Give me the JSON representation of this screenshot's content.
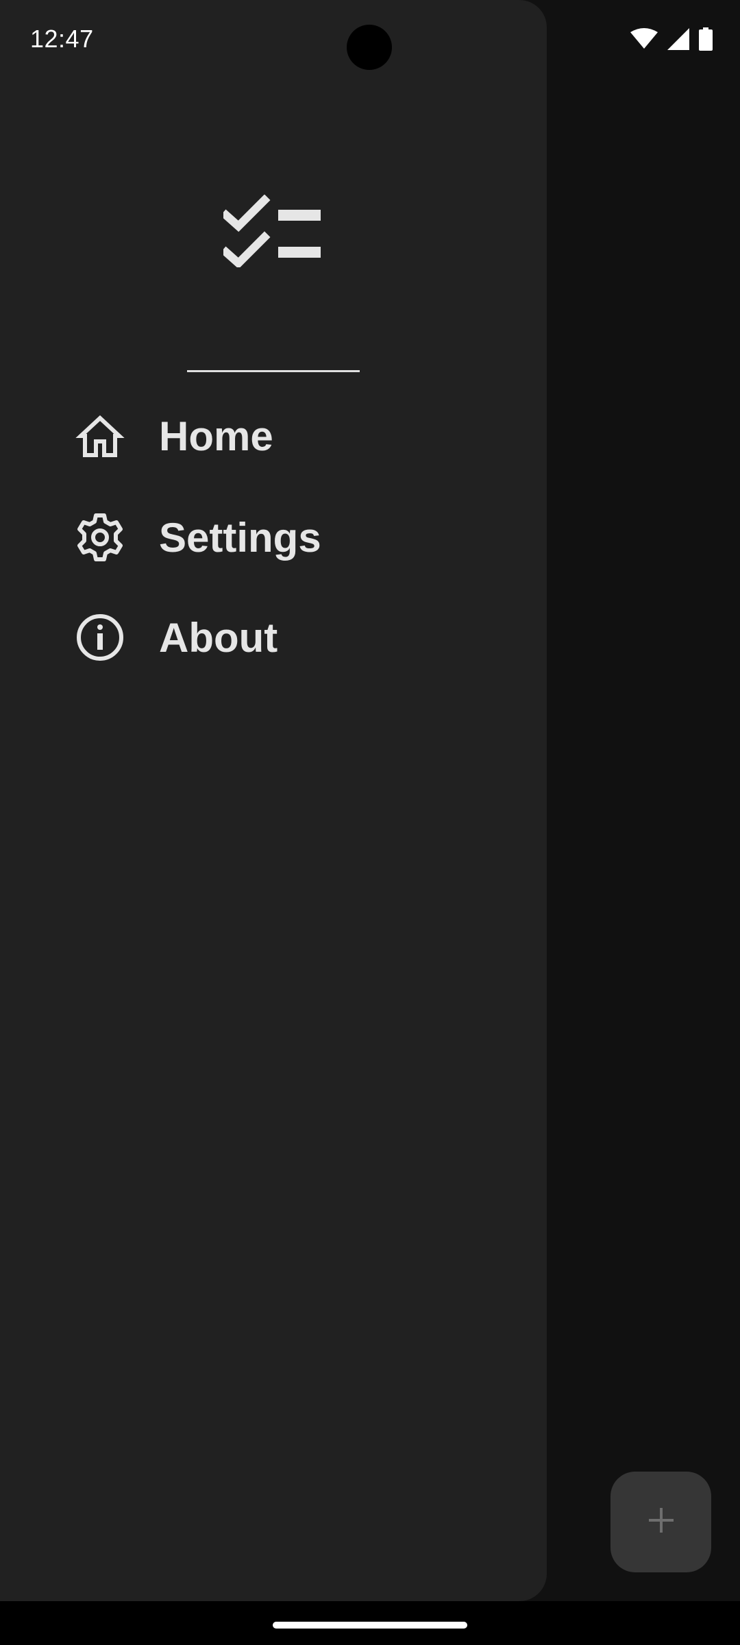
{
  "status_bar": {
    "time": "12:47",
    "icons": [
      "wifi-icon",
      "cellular-signal-icon",
      "battery-icon"
    ]
  },
  "drawer": {
    "logo_icon": "checklist-icon",
    "items": [
      {
        "label": "Home",
        "icon": "home-icon"
      },
      {
        "label": "Settings",
        "icon": "gear-icon"
      },
      {
        "label": "About",
        "icon": "info-icon"
      }
    ]
  },
  "fab": {
    "icon": "plus-icon"
  },
  "colors": {
    "drawer_bg": "#212121",
    "scrim_bg": "#111111",
    "text": "#e6e6e6",
    "fab_bg": "#363636",
    "fab_icon": "#6e6e6e"
  }
}
